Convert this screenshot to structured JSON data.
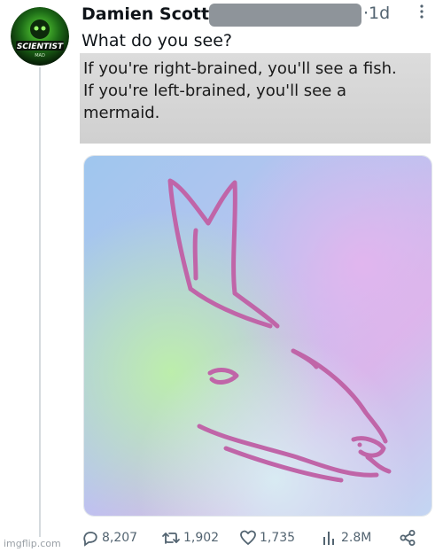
{
  "post": {
    "author_name": "Damien Scott",
    "time_ago": "1d",
    "time_separator": "·",
    "text": "What do you see?",
    "avatar_label": "SCIENTIST",
    "avatar_sublabel": "MAD"
  },
  "embedded_caption": {
    "line1": "If you're right-brained, you'll see a fish.",
    "line2": "If you're left-brained, you'll see a",
    "line3": "mermaid."
  },
  "actions": {
    "replies": "8,207",
    "reposts": "1,902",
    "likes": "1,735",
    "views": "2.8M"
  },
  "watermark": "imgflip.com",
  "colors": {
    "accent_text": "#0f1419",
    "secondary_text": "#536471",
    "drawing_stroke": "#c065a8"
  }
}
